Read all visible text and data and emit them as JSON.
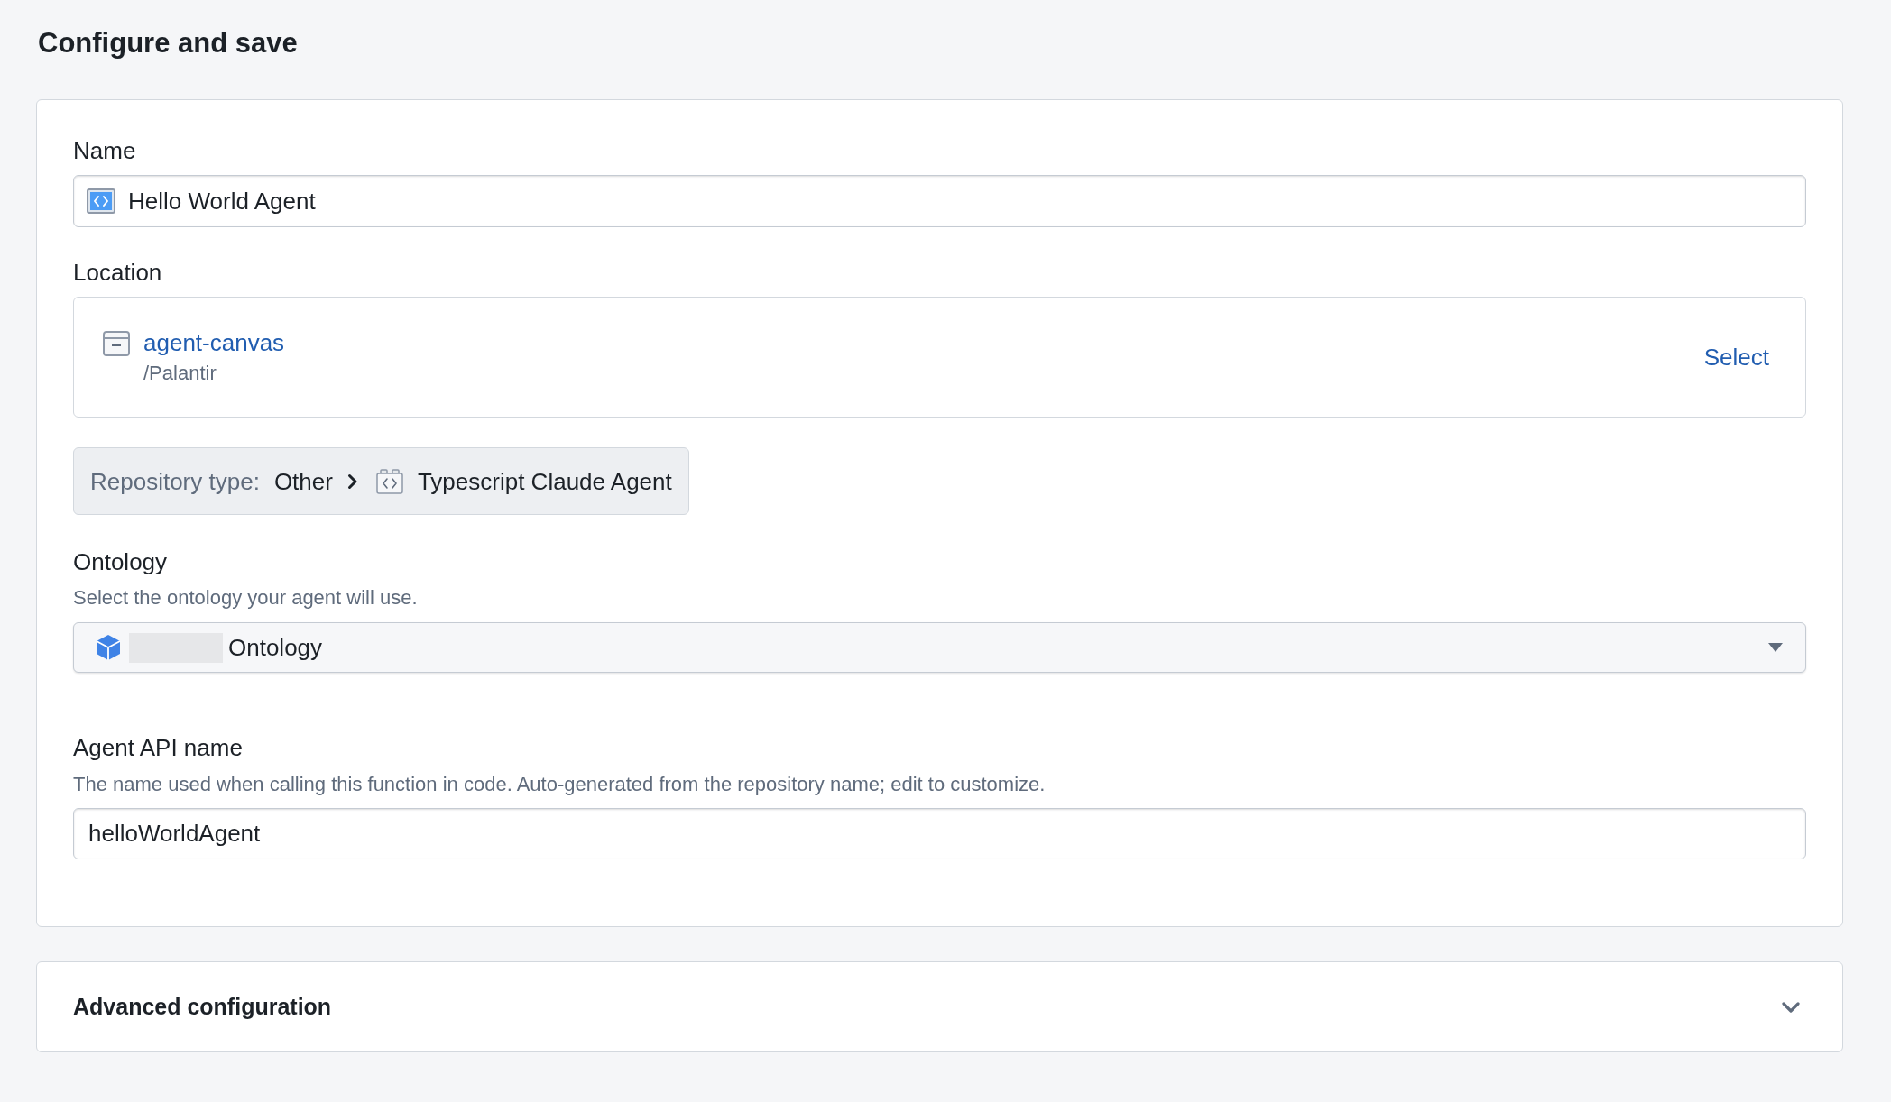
{
  "page": {
    "title": "Configure and save"
  },
  "form": {
    "name": {
      "label": "Name",
      "value": "Hello World Agent"
    },
    "location": {
      "label": "Location",
      "folder": "agent-canvas",
      "path": "/Palantir",
      "action": "Select"
    },
    "repository_type": {
      "label": "Repository type:",
      "category": "Other",
      "template": "Typescript Claude Agent"
    },
    "ontology": {
      "label": "Ontology",
      "description": "Select the ontology your agent will use.",
      "value": "Ontology",
      "name_redacted": true
    },
    "api_name": {
      "label": "Agent API name",
      "description": "The name used when calling this function in code. Auto-generated from the repository name; edit to customize.",
      "value": "helloWorldAgent"
    }
  },
  "advanced_configuration": {
    "title": "Advanced configuration",
    "expanded": false
  }
}
